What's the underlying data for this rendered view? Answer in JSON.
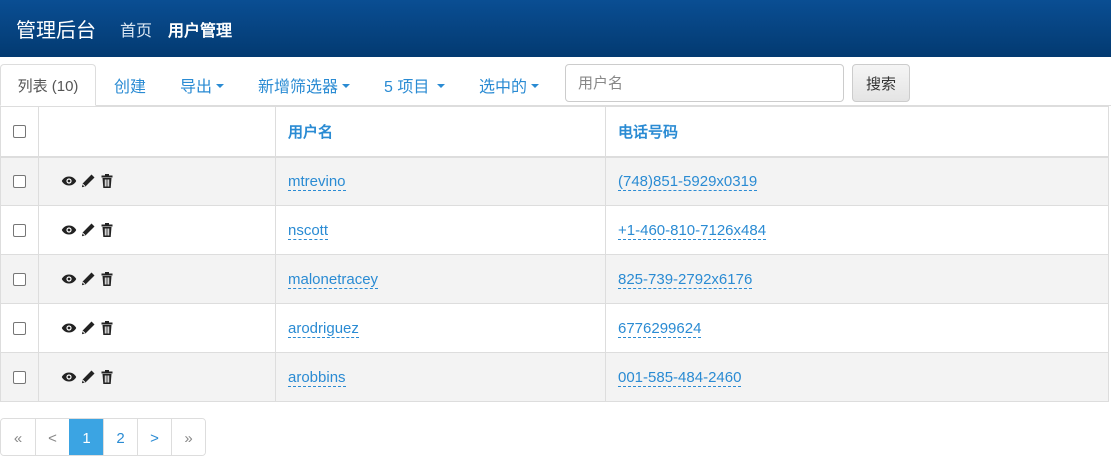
{
  "navbar": {
    "brand": "管理后台",
    "links": [
      {
        "label": "首页",
        "active": false
      },
      {
        "label": "用户管理",
        "active": true
      }
    ]
  },
  "toolbar": {
    "list_tab": "列表 (10)",
    "create": "创建",
    "export": "导出",
    "add_filter": "新增筛选器",
    "per_page": "5 项目",
    "selected": "选中的",
    "search_placeholder": "用户名",
    "search_value": "",
    "search_button": "搜索"
  },
  "table": {
    "headers": {
      "username": "用户名",
      "phone": "电话号码"
    },
    "rows": [
      {
        "username": "mtrevino",
        "phone": "(748)851-5929x0319"
      },
      {
        "username": "nscott",
        "phone": "+1-460-810-7126x484"
      },
      {
        "username": "malonetracey",
        "phone": "825-739-2792x6176"
      },
      {
        "username": "arodriguez",
        "phone": "6776299624"
      },
      {
        "username": "arobbins",
        "phone": "001-585-484-2460"
      }
    ],
    "row_actions": [
      "eye-icon",
      "pencil-icon",
      "trash-icon"
    ]
  },
  "pagination": {
    "first": "«",
    "prev": "<",
    "pages": [
      "1",
      "2"
    ],
    "current": "1",
    "next": ">",
    "last": "»"
  },
  "colors": {
    "navbar": "#033a71",
    "link": "#2a8bd3",
    "active_page": "#3ba4e3"
  }
}
